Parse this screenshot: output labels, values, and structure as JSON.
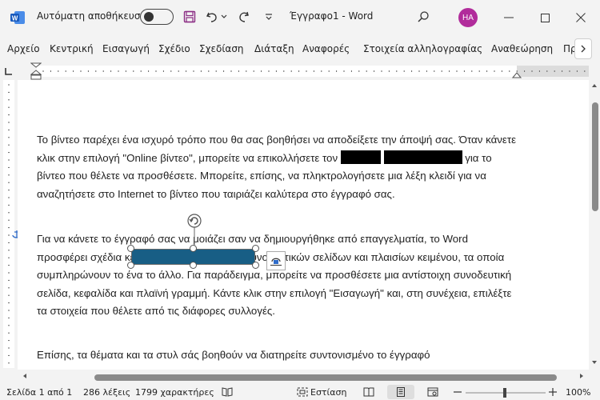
{
  "window": {
    "autosave_label": "Αυτόματη αποθήκευση",
    "doc_title": "Έγγραφο1  -  Word",
    "avatar_initials": "HA"
  },
  "ribbon": {
    "tabs": [
      {
        "label": "Αρχείο"
      },
      {
        "label": "Κεντρική"
      },
      {
        "label": "Εισαγωγή"
      },
      {
        "label": "Σχέδιο"
      },
      {
        "label": "Σχεδίαση"
      },
      {
        "label": "Διάταξη"
      },
      {
        "label": "Αναφορές"
      },
      {
        "label": "Στοιχεία αλληλογραφίας"
      },
      {
        "label": "Αναθεώρηση"
      },
      {
        "label": "Πρ"
      }
    ]
  },
  "document": {
    "p1_a": "Το βίντεο παρέχει ένα ισχυρό τρόπο που θα σας βοηθήσει να αποδείξετε την άποψή σας. Όταν κάνετε κλικ στην επιλογή \"Online βίντεο\", μπορείτε να επικολλήσετε τον ",
    "p1_b": " για το βίντεο που θέλετε να προσθέσετε. Μπορείτε, επίσης, να πληκτρολογήσετε μια λέξη κλειδί για να αναζητήσετε στο Internet το βίντεο που ταιριάζει καλύτερα στο έγγραφό σας.",
    "p2": "Για να κάνετε το έγγραφό σας να μοιάζει σαν να δημιουργήθηκε από επαγγελματία, το Word προσφέρει σχέδια κεφαλίδων, υποσέλιδων, συνοδευτικών σελίδων και πλαισίων κειμένου, τα οποία συμπληρώνουν το ένα το άλλο. Για παράδειγμα, μπορείτε να προσθέσετε μια αντίστοιχη συνοδευτική σελίδα, κεφαλίδα και πλαϊνή γραμμή. Κάντε κλικ στην επιλογή \"Εισαγωγή\" και, στη συνέχεια, επιλέξτε τα στοιχεία που θέλετε από τις διάφορες συλλογές.",
    "p3": "Επίσης, τα θέματα και τα στυλ σάς βοηθούν να διατηρείτε συντονισμένο το έγγραφό"
  },
  "status": {
    "page": "Σελίδα 1 από 1",
    "words": "286 λέξεις",
    "chars": "1799 χαρακτήρες",
    "focus": "Εστίαση",
    "zoom": "100%"
  },
  "colors": {
    "shape_fill": "#185e85",
    "accent": "#b12c9b",
    "word_blue": "#185abd"
  }
}
